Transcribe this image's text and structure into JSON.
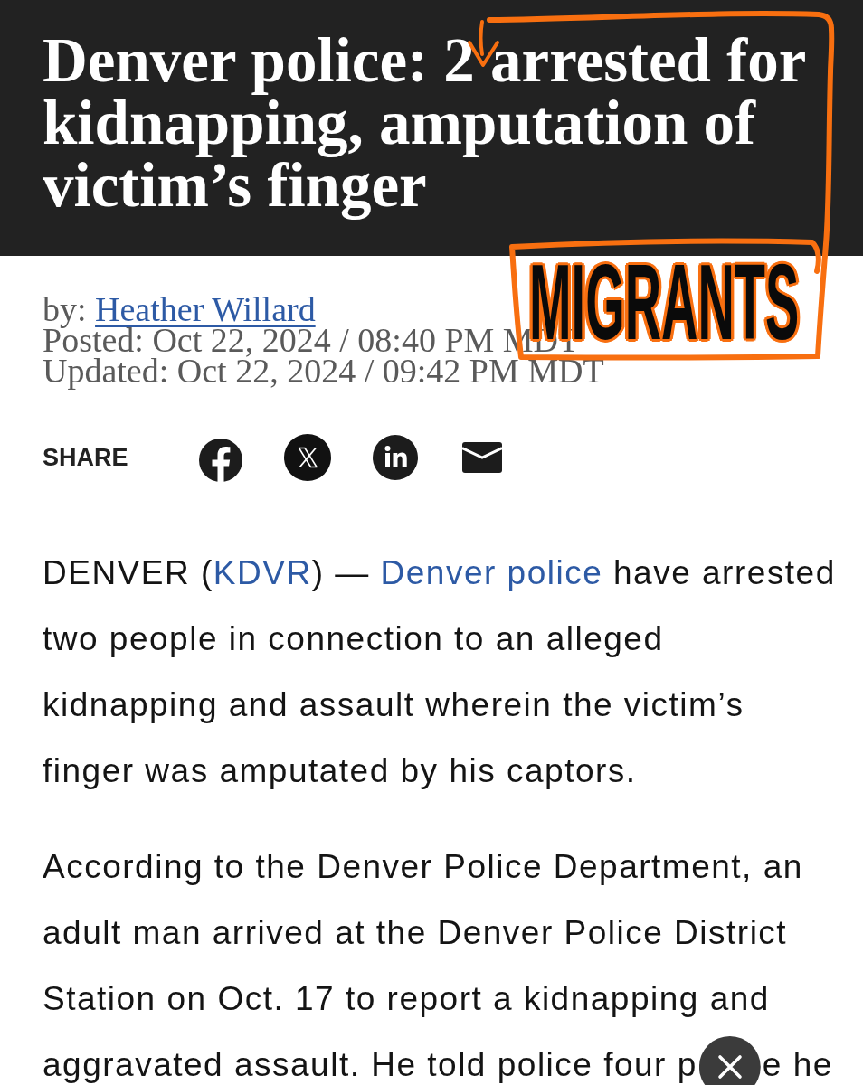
{
  "article": {
    "headline": "Denver police: 2 arrested for kidnapping, amputation of victim’s finger",
    "byline": {
      "label": "by:",
      "author": "Heather Willard"
    },
    "posted": "Posted: Oct 22, 2024 / 08:40 PM MDT",
    "updated": "Updated: Oct 22, 2024 / 09:42 PM MDT",
    "share_label": "SHARE",
    "paragraphs": [
      {
        "segments": [
          {
            "text": "DENVER (",
            "kind": "plain"
          },
          {
            "text": "KDVR",
            "kind": "link"
          },
          {
            "text": ") — ",
            "kind": "plain"
          },
          {
            "text": "Denver police",
            "kind": "link"
          },
          {
            "text": " have arrested two people in connection to an alleged kidnapping and assault wherein the victim’s finger was amputated by his captors.",
            "kind": "plain"
          }
        ]
      },
      {
        "segments": [
          {
            "text": "According to the Denver Police Department, an adult man arrived at the Denver Police District Station on Oct. 17 to report a kidnapping and aggravated assault. He told police four p",
            "kind": "plain"
          }
        ],
        "text_after_close_button": "e he"
      }
    ]
  },
  "annotation": {
    "text": "MIGRANTS"
  }
}
